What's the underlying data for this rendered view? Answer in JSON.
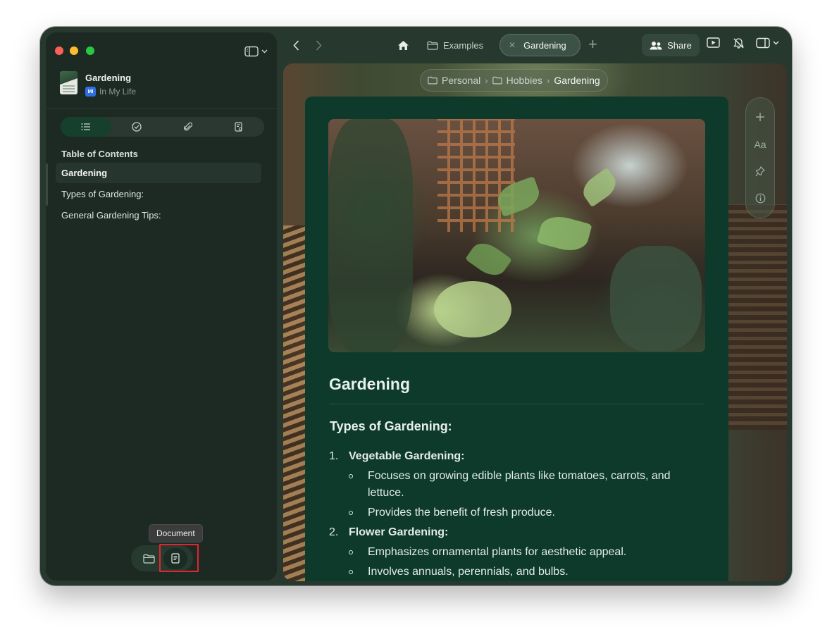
{
  "sidebar": {
    "document": {
      "title": "Gardening",
      "badge": "MI",
      "location": "In My Life"
    },
    "segments": [
      "list-icon",
      "check-circle-icon",
      "paperclip-icon",
      "search-doc-icon"
    ],
    "toc_heading": "Table of Contents",
    "toc_items": [
      {
        "label": "Gardening",
        "active": true
      },
      {
        "label": "Types of Gardening:",
        "active": false
      },
      {
        "label": "General Gardening Tips:",
        "active": false
      }
    ],
    "bottom": {
      "tooltip": "Document"
    }
  },
  "toolbar": {
    "tabs": [
      {
        "label": "Examples",
        "active": false
      },
      {
        "label": "Gardening",
        "active": true
      }
    ],
    "share_label": "Share"
  },
  "breadcrumb": [
    "Personal",
    "Hobbies",
    "Gardening"
  ],
  "content": {
    "title": "Gardening",
    "section_title": "Types of Gardening:",
    "items": [
      {
        "num": "1.",
        "title": "Vegetable Gardening:",
        "bullets": [
          "Focuses on growing edible plants like tomatoes, carrots, and lettuce.",
          "Provides the benefit of fresh produce."
        ]
      },
      {
        "num": "2.",
        "title": "Flower Gardening:",
        "bullets": [
          "Emphasizes ornamental plants for aesthetic appeal.",
          "Involves annuals, perennials, and bulbs."
        ]
      }
    ]
  },
  "float_tools": {
    "font_label": "Aa"
  },
  "colors": {
    "window_bg": "#27392f",
    "sidebar_bg": "#1d2a24",
    "doc_card_bg": "#0d3a2b",
    "highlight": "#e0262f"
  }
}
